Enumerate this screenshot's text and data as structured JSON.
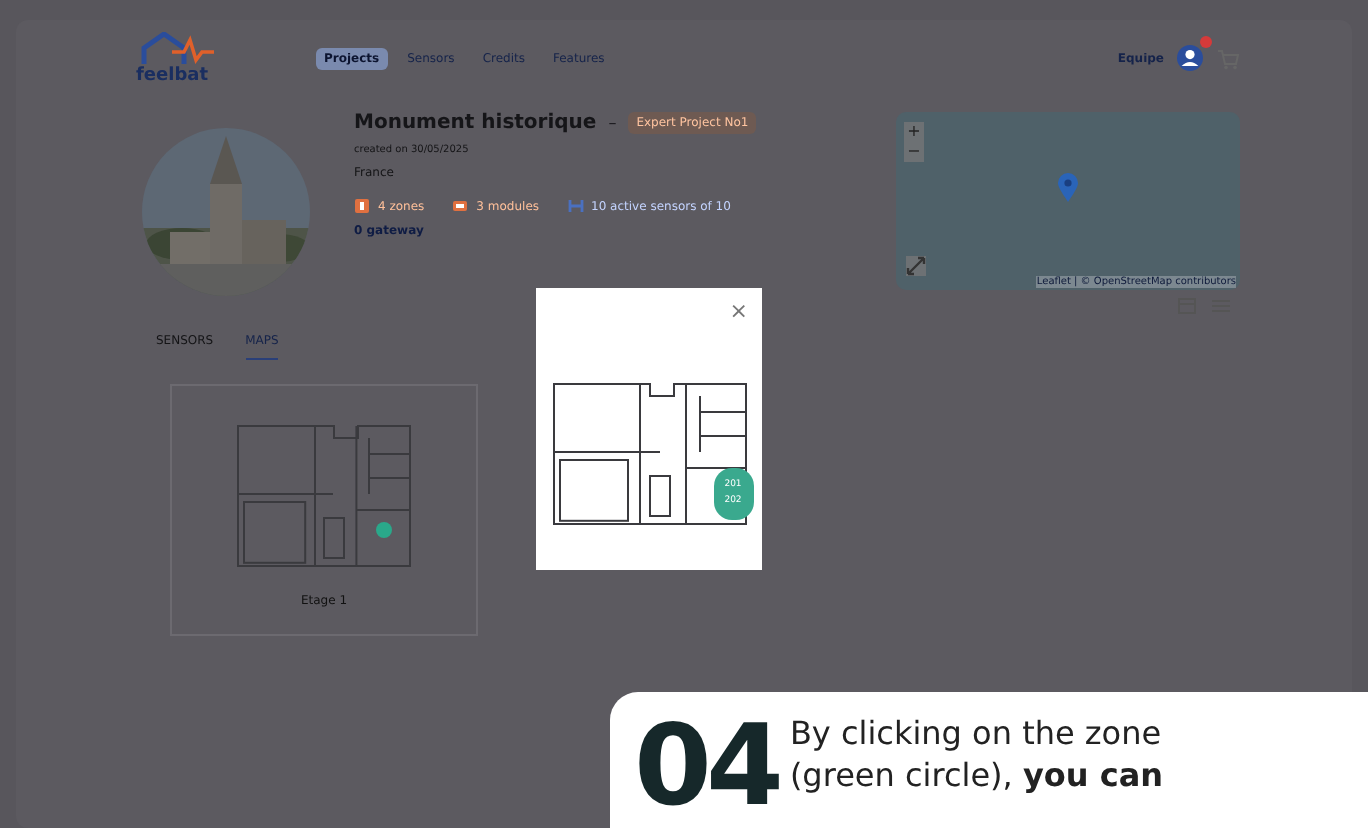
{
  "header": {
    "logo": "feelbat",
    "menu": [
      {
        "label": "Projects",
        "selected": true
      },
      {
        "label": "Sensors",
        "selected": false
      },
      {
        "label": "Credits",
        "selected": false
      },
      {
        "label": "Features",
        "selected": false
      }
    ],
    "team": "Equipe"
  },
  "project": {
    "title": "Monument historique",
    "separator": "–",
    "tag": "Expert Project No1",
    "created": "created on 30/05/2025",
    "country": "France",
    "stats": [
      {
        "kind": "zones",
        "text": "4 zones"
      },
      {
        "kind": "modules",
        "text": "3 modules"
      },
      {
        "kind": "sensors",
        "text": "10 active sensors of 10"
      }
    ],
    "gateway": "0 gateway"
  },
  "map": {
    "zoom_in": "+",
    "zoom_out": "−",
    "attribution": "Leaflet | © OpenStreetMap contributors"
  },
  "tabs": [
    {
      "label": "SENSORS",
      "selected": false
    },
    {
      "label": "MAPS",
      "selected": true
    }
  ],
  "floors": [
    {
      "name": "Etage 1"
    }
  ],
  "modal": {
    "close": "×",
    "zone_labels": [
      "201",
      "202"
    ]
  },
  "caption": {
    "number": "04",
    "text": "By clicking on the zone (green circle), **you can**"
  }
}
